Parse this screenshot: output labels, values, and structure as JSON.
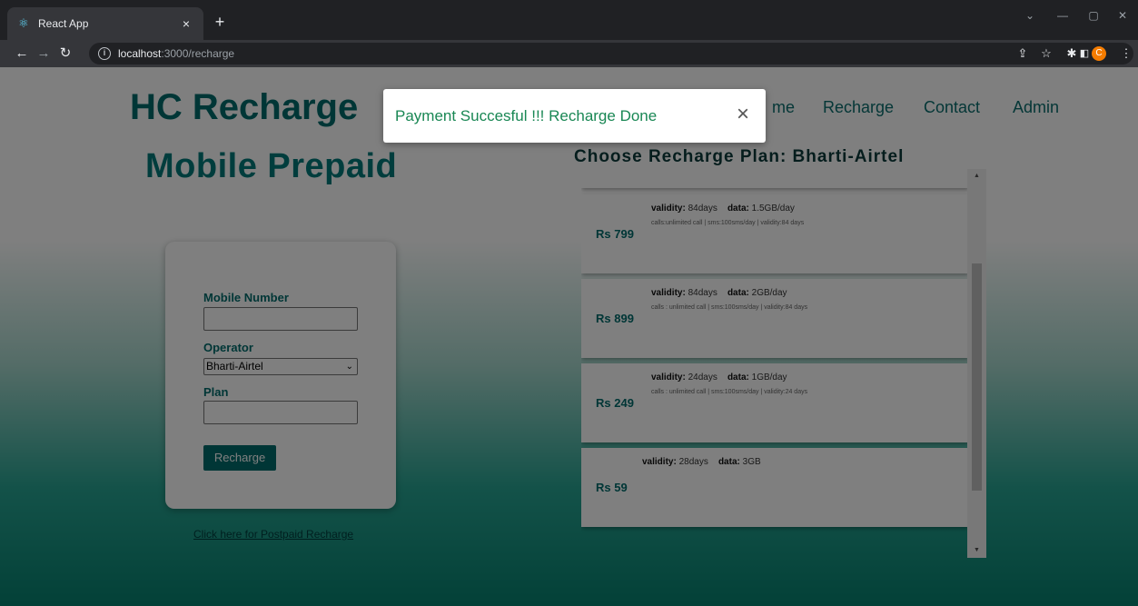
{
  "browser": {
    "tab_title": "React App",
    "tab_close": "×",
    "new_tab": "+",
    "url_host": "localhost",
    "url_rest": ":3000/recharge",
    "profile_initial": "C"
  },
  "site": {
    "brand": "HC Recharge",
    "heading": "Mobile Prepaid",
    "nav": {
      "home_partial": "me",
      "recharge": "Recharge",
      "contact": "Contact",
      "admin": "Admin"
    }
  },
  "form": {
    "mobile_label": "Mobile Number",
    "mobile_value": "",
    "operator_label": "Operator",
    "operator_selected": "Bharti-Airtel",
    "plan_label": "Plan",
    "plan_value": "",
    "submit_label": "Recharge"
  },
  "postpaid_link": "Click here for Postpaid Recharge",
  "plans": {
    "title": "Choose Recharge Plan: Bharti-Airtel",
    "validity_label": "validity:",
    "data_label": "data:",
    "items": [
      {
        "price": "Rs 799",
        "validity": "84days",
        "data": "1.5GB/day",
        "desc": "calls:unlimited call | sms:100sms/day | validity:84 days"
      },
      {
        "price": "Rs 899",
        "validity": "84days",
        "data": "2GB/day",
        "desc": "calls : unlimited call | sms:100sms/day | validity:84 days"
      },
      {
        "price": "Rs 249",
        "validity": "24days",
        "data": "1GB/day",
        "desc": "calls : unlimited call | sms:100sms/day | validity:24 days"
      },
      {
        "price": "Rs 59",
        "validity": "28days",
        "data": "3GB",
        "desc": ""
      }
    ]
  },
  "toast": {
    "message": "Payment Succesful !!! Recharge Done",
    "close": "×"
  },
  "colors": {
    "brand": "#006d6d",
    "success": "#198754",
    "chrome_dark": "#202124"
  }
}
